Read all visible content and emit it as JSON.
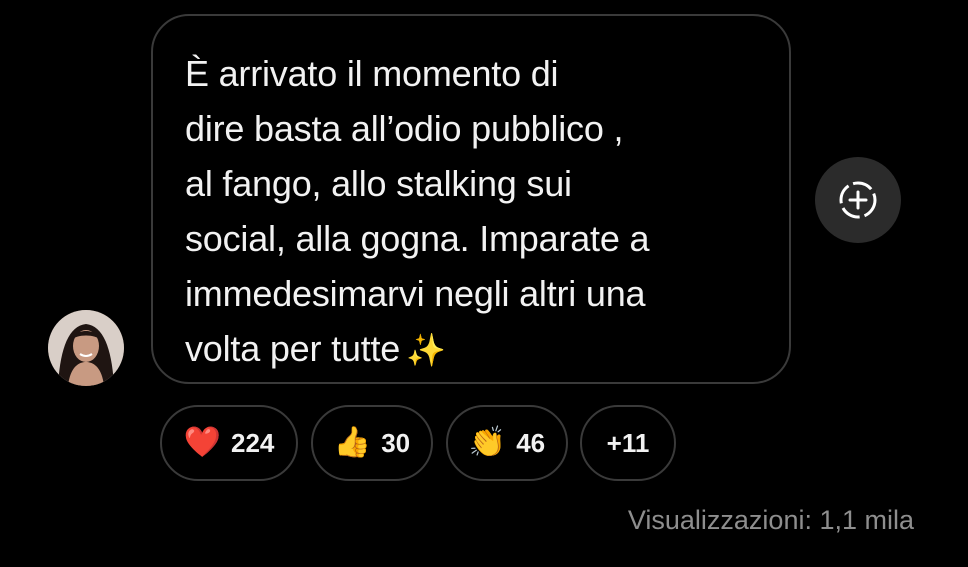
{
  "message": {
    "lines": [
      "È arrivato il momento di",
      "dire basta all’odio pubblico ,",
      "al fango, allo stalking sui",
      "social, alla gogna. Imparate a",
      "immedesimarvi negli altri una",
      "volta per tutte"
    ],
    "trailing_emoji": "✨"
  },
  "avatar": {
    "icon": "profile-photo"
  },
  "share_button": {
    "icon": "add-circle-dashed-icon"
  },
  "reactions": [
    {
      "emoji": "❤️",
      "icon": "red-heart-emoji",
      "count": "224"
    },
    {
      "emoji": "👍",
      "icon": "thumbs-up-emoji",
      "count": "30"
    },
    {
      "emoji": "👏",
      "icon": "clapping-hands-emoji",
      "count": "46"
    },
    {
      "emoji": "",
      "icon": "",
      "count": "+11"
    }
  ],
  "views": "Visualizzazioni: 1,1 mila",
  "colors": {
    "background": "#000000",
    "bubble_border": "#3a3a3a",
    "text": "#f2f2f2",
    "muted_text": "#8e8e8e",
    "share_button_bg": "#2b2b2b"
  }
}
